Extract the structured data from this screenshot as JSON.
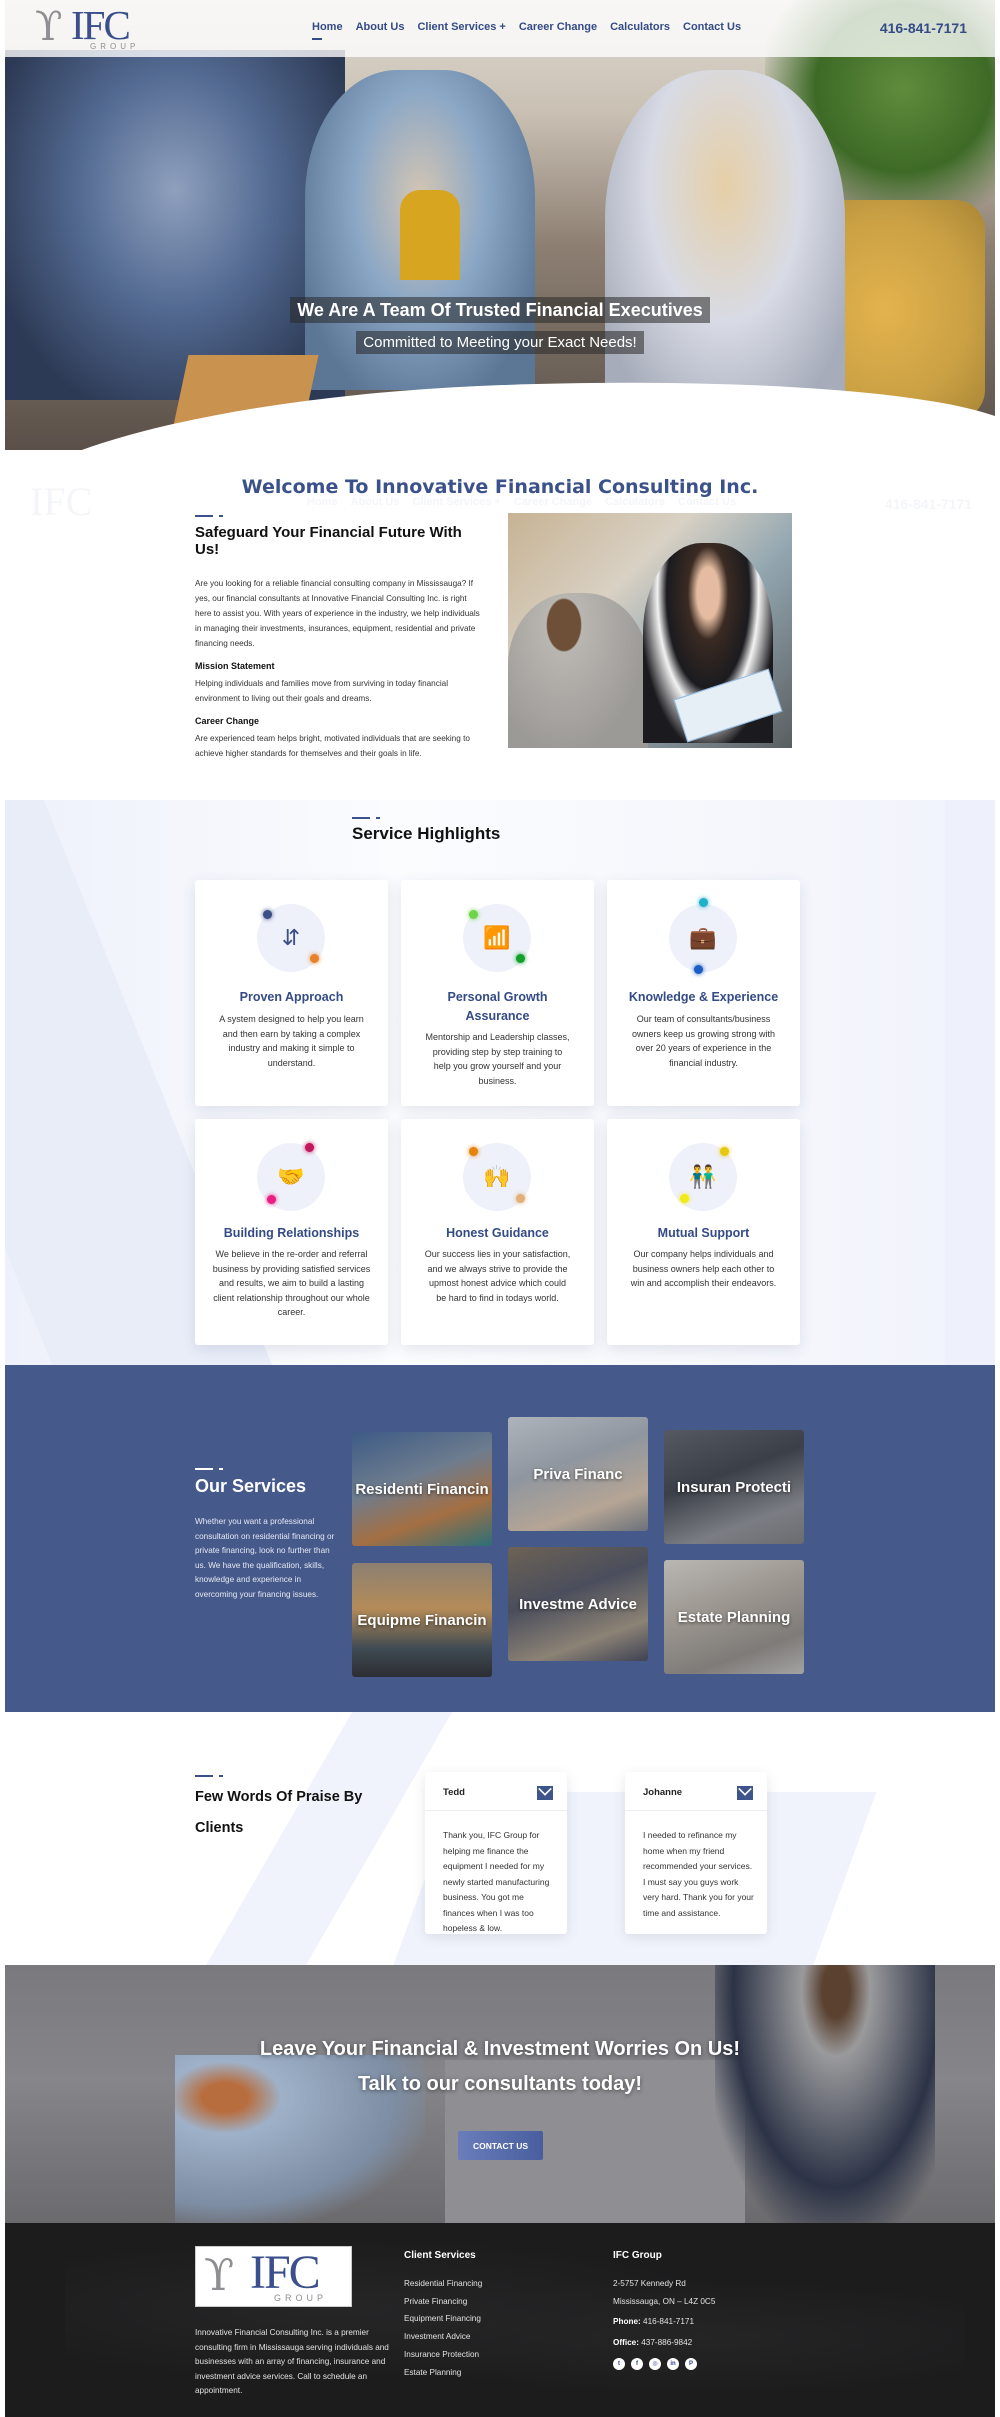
{
  "header": {
    "logo_main": "IFC",
    "logo_sub": "GROUP",
    "nav": [
      {
        "label": "Home",
        "active": true
      },
      {
        "label": "About Us"
      },
      {
        "label": "Client Services +"
      },
      {
        "label": "Career Change"
      },
      {
        "label": "Calculators"
      },
      {
        "label": "Contact Us"
      }
    ],
    "phone": "416-841-7171"
  },
  "hero": {
    "title": "We Are A Team Of Trusted Financial Executives",
    "subtitle": "Committed to Meeting your Exact Needs!"
  },
  "welcome": {
    "title": "Welcome To Innovative Financial Consulting Inc.",
    "heading": "Safeguard Your Financial Future With Us!",
    "intro": "Are you looking for a reliable financial consulting company in Mississauga? If yes, our financial consultants at Innovative Financial Consulting Inc. is right here to assist you. With years of experience in the industry, we help individuals in managing their investments, insurances, equipment, residential and private financing needs.",
    "mission_title": "Mission Statement",
    "mission_text": "Helping individuals and families move from surviving in today financial environment to living out their goals and dreams.",
    "career_title": "Career Change",
    "career_text": "Are experienced team helps bright, motivated individuals that are seeking to achieve higher standards for themselves and their goals in life."
  },
  "highlights": {
    "title": "Service Highlights",
    "cards": [
      {
        "icon": "arrows-split-icon",
        "title": "Proven Approach",
        "text": "A system designed to help you learn and then earn by taking a complex industry and making it simple to understand.",
        "dot_colors": [
          "#3b4e86",
          "#e8822a"
        ]
      },
      {
        "icon": "growth-chart-icon",
        "title": "Personal Growth Assurance",
        "text": "Mentorship and Leadership classes, providing step by step training to help you grow yourself and your business.",
        "dot_colors": [
          "#6fd44a",
          "#13a02b"
        ]
      },
      {
        "icon": "briefcase-icon",
        "title": "Knowledge & Experience",
        "text": "Our team of consultants/business owners keep us growing strong with over 20 years of experience in the financial industry.",
        "dot_colors": [
          "#1fb1c9",
          "#1b5fc4"
        ]
      },
      {
        "icon": "handshake-icon",
        "title": "Building Relationships",
        "text": "We believe in the re-order and referral business by providing satisfied services and results, we aim to build a lasting client relationship throughout our whole career.",
        "dot_colors": [
          "#c2185b",
          "#e91e7f"
        ]
      },
      {
        "icon": "guidance-person-icon",
        "title": "Honest Guidance",
        "text": "Our success lies in your satisfaction, and we always strive to provide the upmost honest advice which could be hard to find in todays world.",
        "dot_colors": [
          "#e5830f",
          "#e2b077"
        ]
      },
      {
        "icon": "two-people-icon",
        "title": "Mutual Support",
        "text": "Our company helps individuals and business owners help each other to win and accomplish their endeavors.",
        "dot_colors": [
          "#e8c80c",
          "#f2ea16"
        ]
      }
    ]
  },
  "services": {
    "title": "Our Services",
    "text": "Whether you want a professional consultation on residential financing or private financing, look no further than us. We have the qualification, skills, knowledge and experience in overcoming your financing issues.",
    "tiles": [
      {
        "label": "Residenti Financin"
      },
      {
        "label": "Priva Financ"
      },
      {
        "label": "Insuran Protecti"
      },
      {
        "label": "Equipme Financin"
      },
      {
        "label": "Investme Advice"
      },
      {
        "label": "Estate Planning"
      }
    ]
  },
  "praise": {
    "title": "Few Words Of Praise By Clients",
    "testimonials": [
      {
        "name": "Tedd",
        "text": "Thank you, IFC Group for helping me finance the equipment I needed for my newly started manufacturing business. You got me finances when I was too hopeless & low."
      },
      {
        "name": "Johanne",
        "text": "I needed to refinance my home when my friend recommended your services. I must say you guys work very hard. Thank you for your time and assistance."
      }
    ]
  },
  "cta": {
    "line1": "Leave Your Financial & Investment Worries On Us!",
    "line2": "Talk to our consultants today!",
    "button": "CONTACT US"
  },
  "footer": {
    "about": "Innovative Financial Consulting Inc. is a premier consulting firm in Mississauga serving individuals and businesses with an array of financing, insurance and investment advice services. Call to schedule an appointment.",
    "services_title": "Client Services",
    "services": [
      "Residential Financing",
      "Private Financing",
      "Equipment Financing",
      "Investment Advice",
      "Insurance Protection",
      "Estate Planning"
    ],
    "company_title": "IFC Group",
    "address1": "2-5757 Kennedy Rd",
    "address2": "Mississauga, ON – L4Z 0C5",
    "phone_label": "Phone:",
    "phone": "416-841-7171",
    "office_label": "Office:",
    "office": "437-886-9842",
    "socials": [
      {
        "name": "twitter-icon",
        "glyph": "t"
      },
      {
        "name": "facebook-icon",
        "glyph": "f"
      },
      {
        "name": "instagram-icon",
        "glyph": "◎"
      },
      {
        "name": "linkedin-icon",
        "glyph": "in"
      },
      {
        "name": "pinterest-icon",
        "glyph": "P"
      }
    ]
  }
}
